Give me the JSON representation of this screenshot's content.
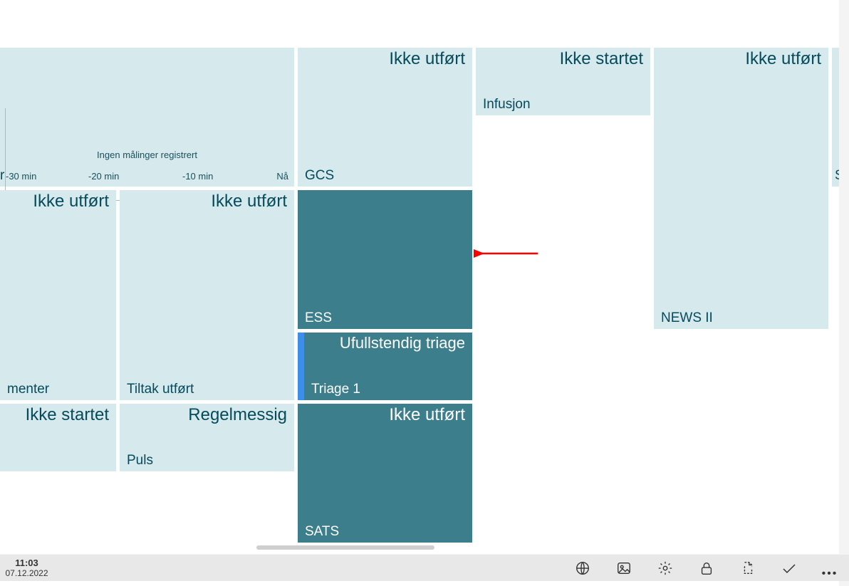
{
  "chart": {
    "message": "Ingen målinger registrert",
    "ticks": [
      "-30 min",
      "-20 min",
      "-10 min",
      "Nå"
    ],
    "bottom_label": "r"
  },
  "tiles": {
    "gcs": {
      "status": "Ikke utført",
      "label": "GCS"
    },
    "infusjon": {
      "status": "Ikke startet",
      "label": "Infusjon"
    },
    "newsii": {
      "status": "Ikke utført",
      "label": "NEWS II"
    },
    "cut_right": {
      "status": "",
      "label": "S"
    },
    "menter": {
      "status": "Ikke utført",
      "label": "menter"
    },
    "tiltak": {
      "status": "Ikke utført",
      "label": "Tiltak utført"
    },
    "ess": {
      "status": "",
      "label": "ESS"
    },
    "triage": {
      "status": "Ufullstendig triage",
      "label": "Triage 1"
    },
    "sats": {
      "status": "Ikke utført",
      "label": "SATS"
    },
    "bottom_left": {
      "status": "Ikke startet",
      "label": ""
    },
    "puls": {
      "status": "Regelmessig",
      "label": "Puls"
    }
  },
  "taskbar": {
    "time": "11:03",
    "date": "07.12.2022"
  }
}
